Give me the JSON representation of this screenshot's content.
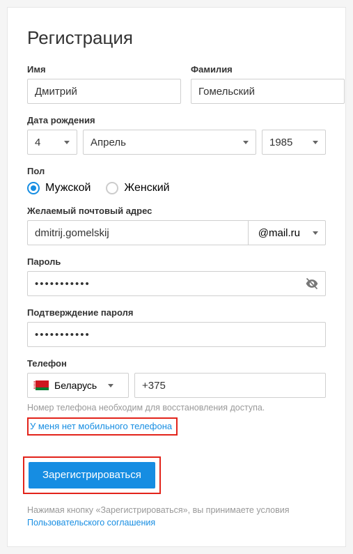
{
  "title": "Регистрация",
  "labels": {
    "first_name": "Имя",
    "last_name": "Фамилия",
    "dob": "Дата рождения",
    "gender": "Пол",
    "email": "Желаемый почтовый адрес",
    "password": "Пароль",
    "password_confirm": "Подтверждение пароля",
    "phone": "Телефон"
  },
  "values": {
    "first_name": "Дмитрий",
    "last_name": "Гомельский",
    "dob_day": "4",
    "dob_month": "Апрель",
    "dob_year": "1985",
    "email_user": "dmitrij.gomelskij",
    "email_domain": "@mail.ru",
    "password_masked": "•••••••••••",
    "password_confirm_masked": "•••••••••••",
    "phone_country": "Беларусь",
    "phone_prefix": "+375"
  },
  "gender": {
    "male": "Мужской",
    "female": "Женский",
    "selected": "male"
  },
  "hints": {
    "phone": "Номер телефона необходим для восстановления доступа."
  },
  "links": {
    "no_phone": "У меня нет мобильного телефона",
    "terms": "Пользовательского соглашения"
  },
  "buttons": {
    "submit": "Зарегистрироваться"
  },
  "terms_prefix": "Нажимая кнопку «Зарегистрироваться», вы принимаете условия "
}
